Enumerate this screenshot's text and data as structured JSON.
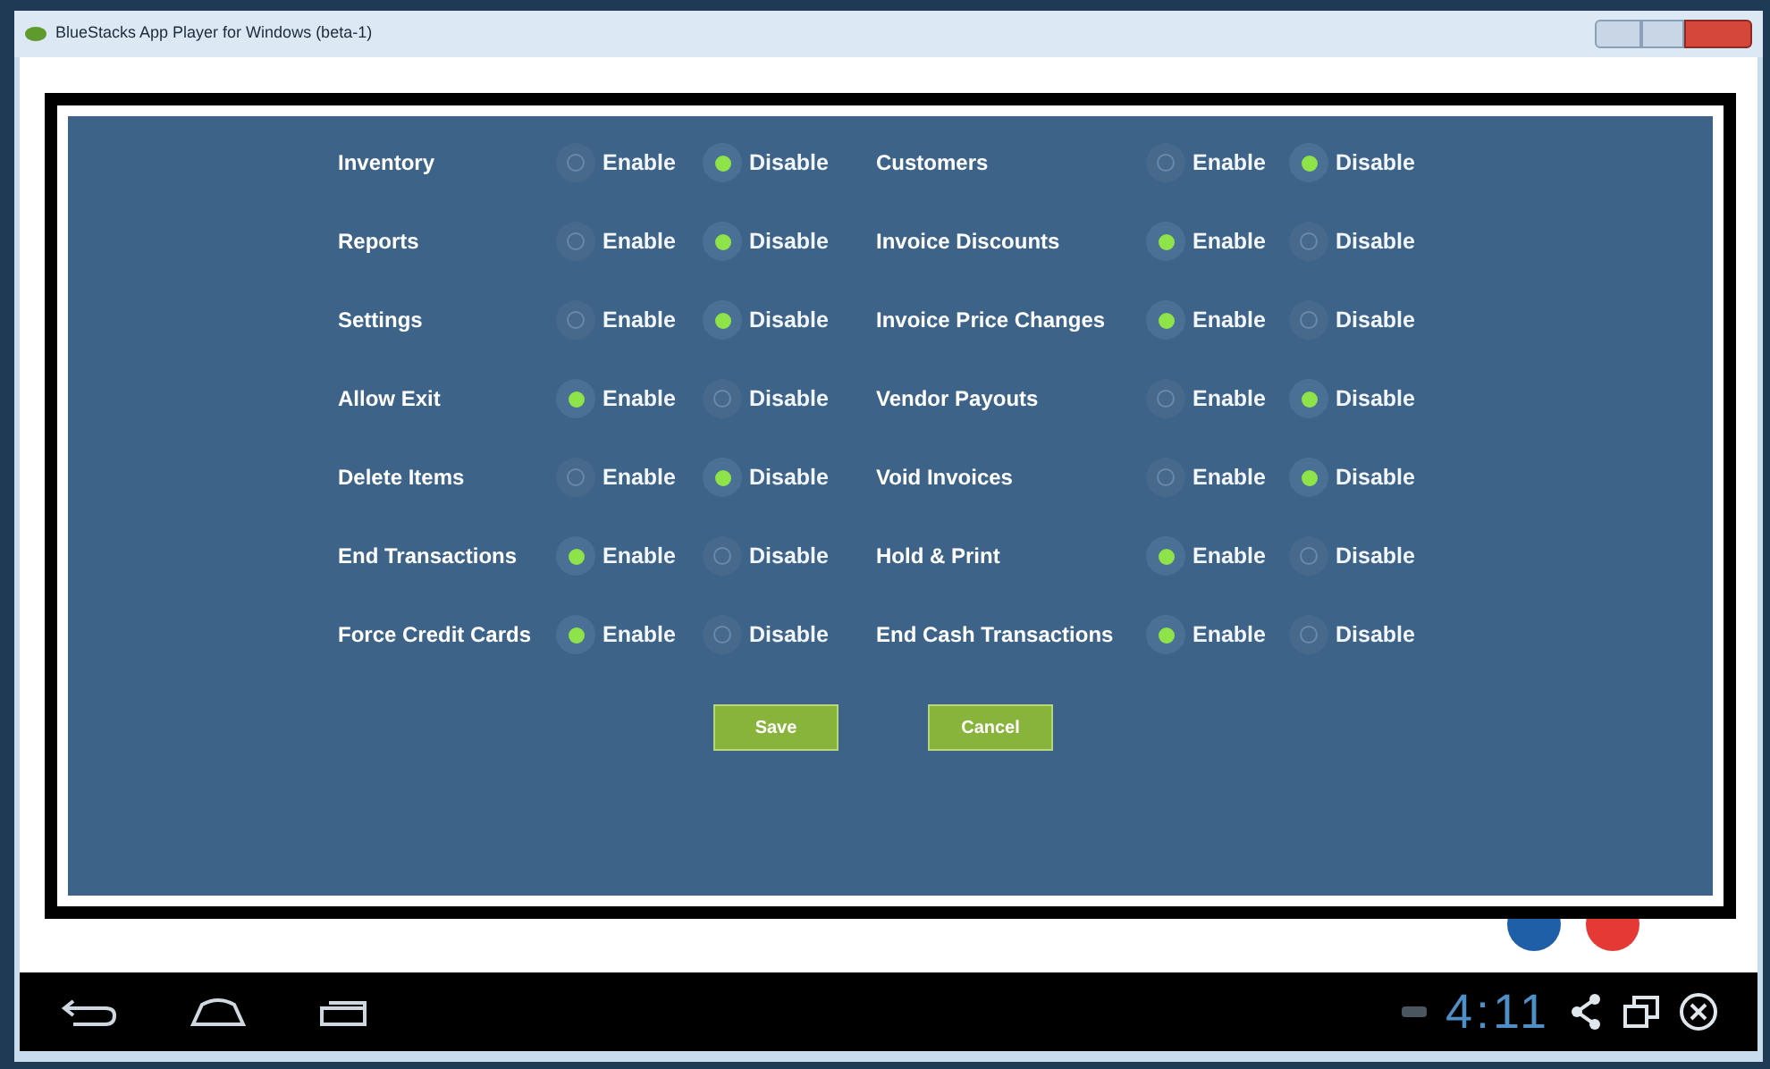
{
  "window": {
    "title": "BlueStacks App Player for Windows (beta-1)"
  },
  "permissions": [
    {
      "label": "Inventory",
      "options": [
        {
          "label": "Enable",
          "selected": false
        },
        {
          "label": "Disable",
          "selected": true
        }
      ]
    },
    {
      "label": "Customers",
      "options": [
        {
          "label": "Enable",
          "selected": false
        },
        {
          "label": "Disable",
          "selected": true
        }
      ]
    },
    {
      "label": "Reports",
      "options": [
        {
          "label": "Enable",
          "selected": false
        },
        {
          "label": "Disable",
          "selected": true
        }
      ]
    },
    {
      "label": "Invoice Discounts",
      "options": [
        {
          "label": "Enable",
          "selected": true
        },
        {
          "label": "Disable",
          "selected": false
        }
      ]
    },
    {
      "label": "Settings",
      "options": [
        {
          "label": "Enable",
          "selected": false
        },
        {
          "label": "Disable",
          "selected": true
        }
      ]
    },
    {
      "label": "Invoice Price Changes",
      "options": [
        {
          "label": "Enable",
          "selected": true
        },
        {
          "label": "Disable",
          "selected": false
        }
      ]
    },
    {
      "label": "Allow Exit",
      "options": [
        {
          "label": "Enable",
          "selected": true
        },
        {
          "label": "Disable",
          "selected": false
        }
      ]
    },
    {
      "label": "Vendor Payouts",
      "options": [
        {
          "label": "Enable",
          "selected": false
        },
        {
          "label": "Disable",
          "selected": true
        }
      ]
    },
    {
      "label": "Delete Items",
      "options": [
        {
          "label": "Enable",
          "selected": false
        },
        {
          "label": "Disable",
          "selected": true
        }
      ]
    },
    {
      "label": "Void Invoices",
      "options": [
        {
          "label": "Enable",
          "selected": false
        },
        {
          "label": "Disable",
          "selected": true
        }
      ]
    },
    {
      "label": "End Transactions",
      "options": [
        {
          "label": "Enable",
          "selected": true
        },
        {
          "label": "Disable",
          "selected": false
        }
      ]
    },
    {
      "label": "Hold & Print",
      "options": [
        {
          "label": "Enable",
          "selected": true
        },
        {
          "label": "Disable",
          "selected": false
        }
      ]
    },
    {
      "label": "Force Credit Cards",
      "options": [
        {
          "label": "Enable",
          "selected": true
        },
        {
          "label": "Disable",
          "selected": false
        }
      ]
    },
    {
      "label": "End Cash Transactions",
      "options": [
        {
          "label": "Enable",
          "selected": true
        },
        {
          "label": "Disable",
          "selected": false
        }
      ]
    }
  ],
  "buttons": [
    "Save",
    "Cancel"
  ],
  "navigation_bar": {
    "time": "4:11"
  }
}
